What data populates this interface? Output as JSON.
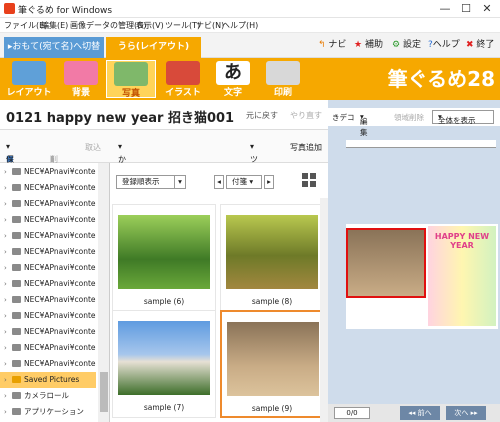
{
  "window": {
    "title": "筆ぐるめ for Windows"
  },
  "menu": [
    "ファイル(E)",
    "編集(E)",
    "画像データの管理(G)",
    "表示(V)",
    "ツール(T)",
    "ナビ(N)",
    "ヘルプ(H)"
  ],
  "mode_tabs": {
    "front": "▸おもて(宛て名)へ切替",
    "back": "うら(レイアウト)"
  },
  "top_actions": {
    "navi": "ナビ",
    "help_sup": "補助",
    "settings": "設定",
    "help": "ヘルプ",
    "exit": "終了"
  },
  "categories": [
    "レイアウト",
    "背景",
    "写真",
    "イラスト",
    "文字",
    "印刷"
  ],
  "brand": "筆ぐるめ28",
  "document": {
    "title": "0121  happy new year  招き猫001",
    "undo": "元に戻す",
    "redo": "やり直す"
  },
  "photo_toolbar": {
    "save": "保存",
    "delete": "削除",
    "import": "取込",
    "easy_layout": "かんたんレイアウト",
    "tools": "ツール",
    "add_photo": "写真追加"
  },
  "folders": [
    "NEC¥APnavi¥conten...",
    "NEC¥APnavi¥conten...",
    "NEC¥APnavi¥conten...",
    "NEC¥APnavi¥conten...",
    "NEC¥APnavi¥conten...",
    "NEC¥APnavi¥conten...",
    "NEC¥APnavi¥conten...",
    "NEC¥APnavi¥conten...",
    "NEC¥APnavi¥conten...",
    "NEC¥APnavi¥conten...",
    "NEC¥APnavi¥conten...",
    "NEC¥APnavi¥conten...",
    "NEC¥APnavi¥conten...",
    "Saved Pictures",
    "カメラロール",
    "アプリケーション"
  ],
  "view": {
    "sort": "登録順表示",
    "date": "付箋"
  },
  "photos": [
    {
      "label": "sample (6)"
    },
    {
      "label": "sample (8)"
    },
    {
      "label": "sample (7)"
    },
    {
      "label": "sample (9)"
    }
  ],
  "preview": {
    "tabs": [
      "きデコ",
      "編集",
      "領域削除"
    ],
    "fit": "全体を表示",
    "page": "0/0",
    "prev": "前へ",
    "next": "次へ"
  },
  "card": {
    "banner": "HAPPY NEW YEAR"
  }
}
